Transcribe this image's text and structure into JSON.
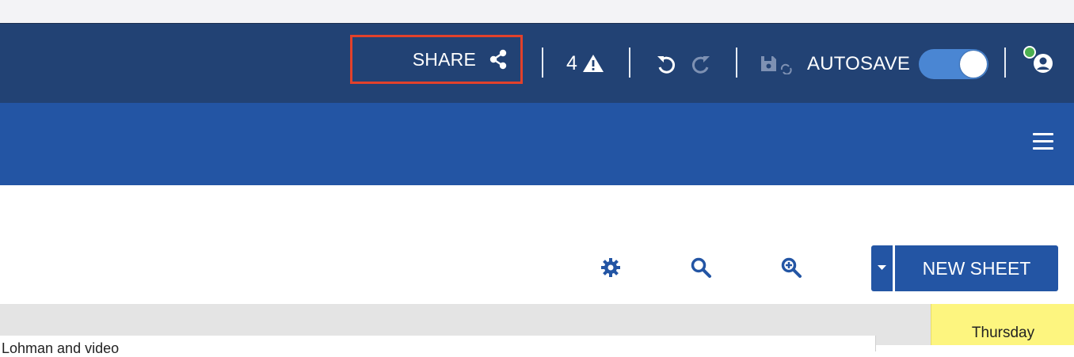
{
  "header": {
    "share_label": "SHARE",
    "warning_count": "4",
    "autosave_label": "AUTOSAVE",
    "autosave_on": true,
    "status_color": "#4caf50"
  },
  "toolbar": {
    "new_sheet_label": "NEW SHEET"
  },
  "content": {
    "sheet_text": "Lohman and video",
    "day_label": "Thursday"
  },
  "icons": {
    "share": "share-icon",
    "warning": "warning-triangle-icon",
    "undo": "undo-icon",
    "redo": "redo-icon",
    "save": "save-sync-icon",
    "user": "user-icon",
    "menu": "hamburger-menu-icon",
    "settings": "gear-icon",
    "search": "search-icon",
    "zoom": "zoom-in-icon",
    "dropdown": "caret-down-icon"
  },
  "colors": {
    "header_bg": "#224274",
    "nav_bg": "#2355a4",
    "highlight": "#e2412b",
    "toggle": "#4a86d3",
    "day_card": "#fdf57f"
  }
}
